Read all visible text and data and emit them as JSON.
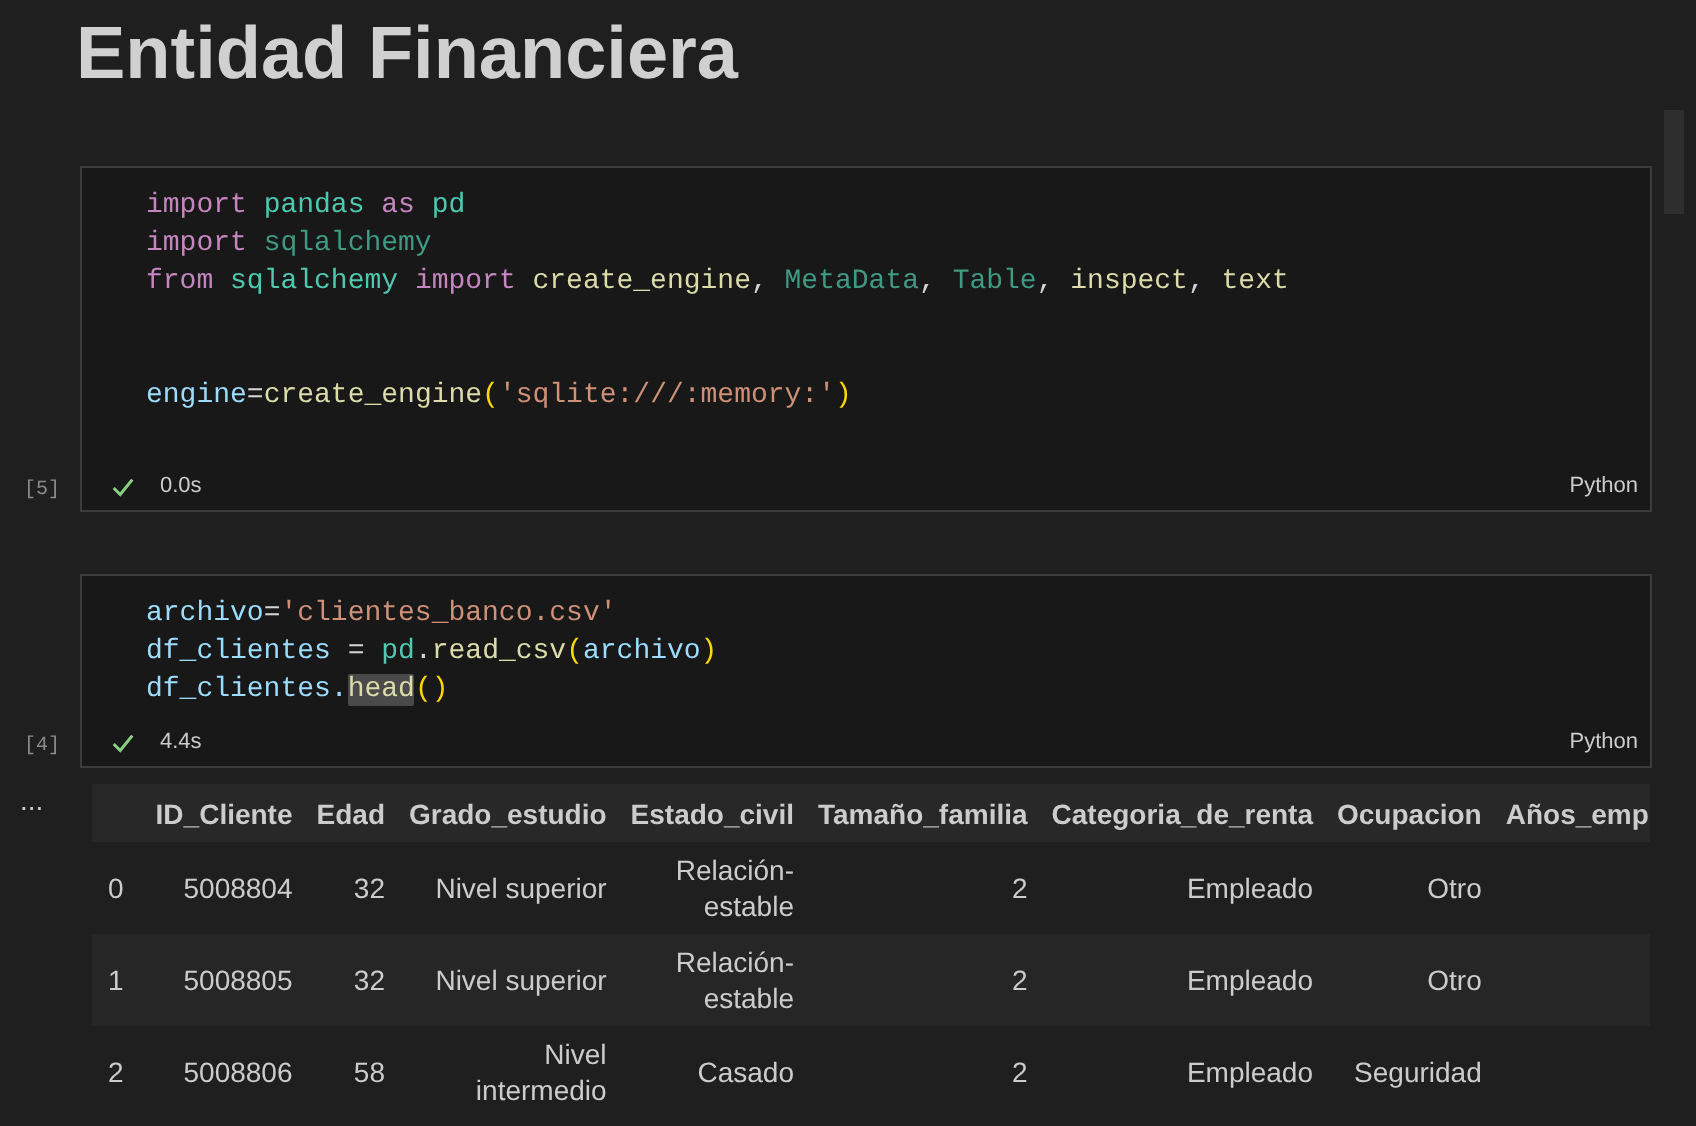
{
  "title": "Entidad Financiera",
  "cells": [
    {
      "count": "[5]",
      "succeeded": true,
      "duration": "0.0s",
      "language": "Python",
      "lines": [
        {
          "kind": "code",
          "tokens": [
            {
              "kind": "keyword",
              "text": "import "
            },
            {
              "kind": "module",
              "text": "pandas "
            },
            {
              "kind": "keyword",
              "text": "as "
            },
            {
              "kind": "module",
              "text": "pd"
            }
          ]
        },
        {
          "kind": "code",
          "tokens": [
            {
              "kind": "keyword",
              "text": "import "
            },
            {
              "kind": "unused",
              "text": "sqlalchemy"
            }
          ]
        },
        {
          "kind": "code",
          "tokens": [
            {
              "kind": "keyword",
              "text": "from "
            },
            {
              "kind": "module",
              "text": "sqlalchemy "
            },
            {
              "kind": "keyword",
              "text": "import "
            },
            {
              "kind": "function",
              "text": "create_engine"
            },
            {
              "kind": "plain",
              "text": ", "
            },
            {
              "kind": "unused",
              "text": "MetaData"
            },
            {
              "kind": "plain",
              "text": ", "
            },
            {
              "kind": "unused",
              "text": "Table"
            },
            {
              "kind": "plain",
              "text": ", "
            },
            {
              "kind": "function",
              "text": "inspect"
            },
            {
              "kind": "plain",
              "text": ", "
            },
            {
              "kind": "function",
              "text": "text"
            }
          ]
        },
        {
          "kind": "blank"
        },
        {
          "kind": "blank"
        },
        {
          "kind": "code",
          "tokens": [
            {
              "kind": "variable",
              "text": "engine"
            },
            {
              "kind": "plain",
              "text": "="
            },
            {
              "kind": "function",
              "text": "create_engine"
            },
            {
              "kind": "bracket",
              "text": "("
            },
            {
              "kind": "string",
              "text": "'sqlite:///:memory:'"
            },
            {
              "kind": "bracket",
              "text": ")"
            }
          ]
        },
        {
          "kind": "blank"
        }
      ]
    },
    {
      "count": "[4]",
      "succeeded": true,
      "duration": "4.4s",
      "language": "Python",
      "lines": [
        {
          "kind": "code",
          "tokens": [
            {
              "kind": "variable",
              "text": "archivo"
            },
            {
              "kind": "plain",
              "text": "="
            },
            {
              "kind": "string",
              "text": "'clientes_banco.csv'"
            }
          ]
        },
        {
          "kind": "code",
          "tokens": [
            {
              "kind": "variable",
              "text": "df_clientes"
            },
            {
              "kind": "plain",
              "text": " = "
            },
            {
              "kind": "module",
              "text": "pd"
            },
            {
              "kind": "plain",
              "text": "."
            },
            {
              "kind": "function",
              "text": "read_csv"
            },
            {
              "kind": "bracket",
              "text": "("
            },
            {
              "kind": "variable",
              "text": "archivo"
            },
            {
              "kind": "bracket",
              "text": ")"
            }
          ]
        },
        {
          "kind": "code",
          "tokens": [
            {
              "kind": "variable",
              "text": "df_clientes."
            },
            {
              "kind": "function",
              "text": "head",
              "highlighted": true
            },
            {
              "kind": "bracket",
              "text": "()"
            }
          ]
        }
      ]
    }
  ],
  "output": {
    "menu": "...",
    "columns": [
      "ID_Cliente",
      "Edad",
      "Grado_estudio",
      "Estado_civil",
      "Tamaño_familia",
      "Categoria_de_renta",
      "Ocupacion",
      "Años_emp"
    ],
    "rows": [
      {
        "index": "0",
        "cells": [
          "5008804",
          "32",
          "Nivel superior",
          "Relación-estable",
          "2",
          "Empleado",
          "Otro",
          ""
        ]
      },
      {
        "index": "1",
        "cells": [
          "5008805",
          "32",
          "Nivel superior",
          "Relación-estable",
          "2",
          "Empleado",
          "Otro",
          ""
        ]
      },
      {
        "index": "2",
        "cells": [
          "5008806",
          "58",
          "Nivel intermedio",
          "Casado",
          "2",
          "Empleado",
          "Seguridad",
          ""
        ]
      }
    ]
  }
}
